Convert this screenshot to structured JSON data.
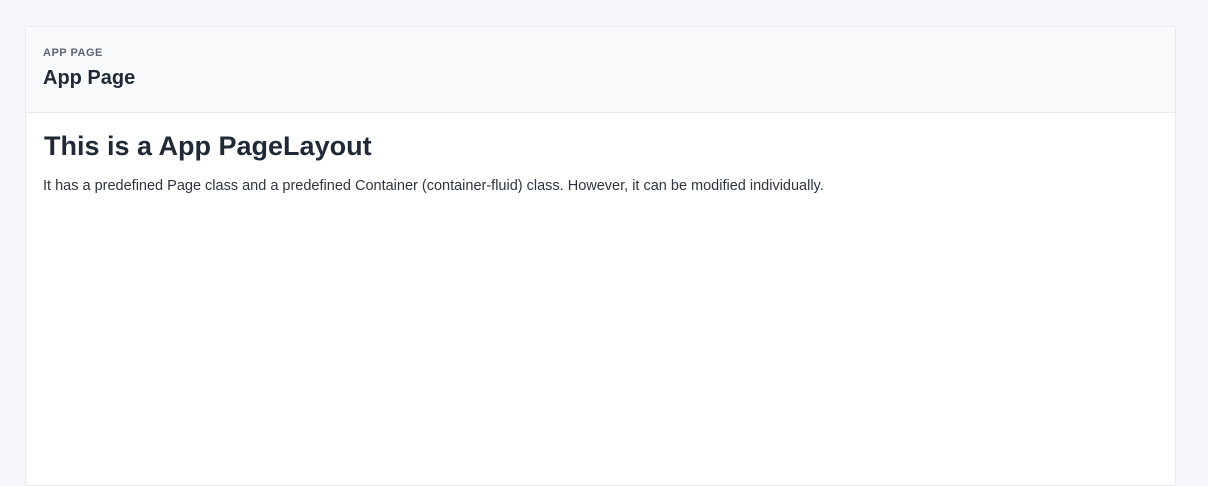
{
  "header": {
    "pretitle": "APP PAGE",
    "title": "App Page"
  },
  "content": {
    "heading": "This is a App PageLayout",
    "text": "It has a predefined Page class and a predefined Container (container-fluid) class. However, it can be modified individually."
  },
  "colors": {
    "background": "#f5f7fb",
    "card": "#ffffff",
    "header_bg": "#f9fafb",
    "text_dark": "#1f2937"
  }
}
